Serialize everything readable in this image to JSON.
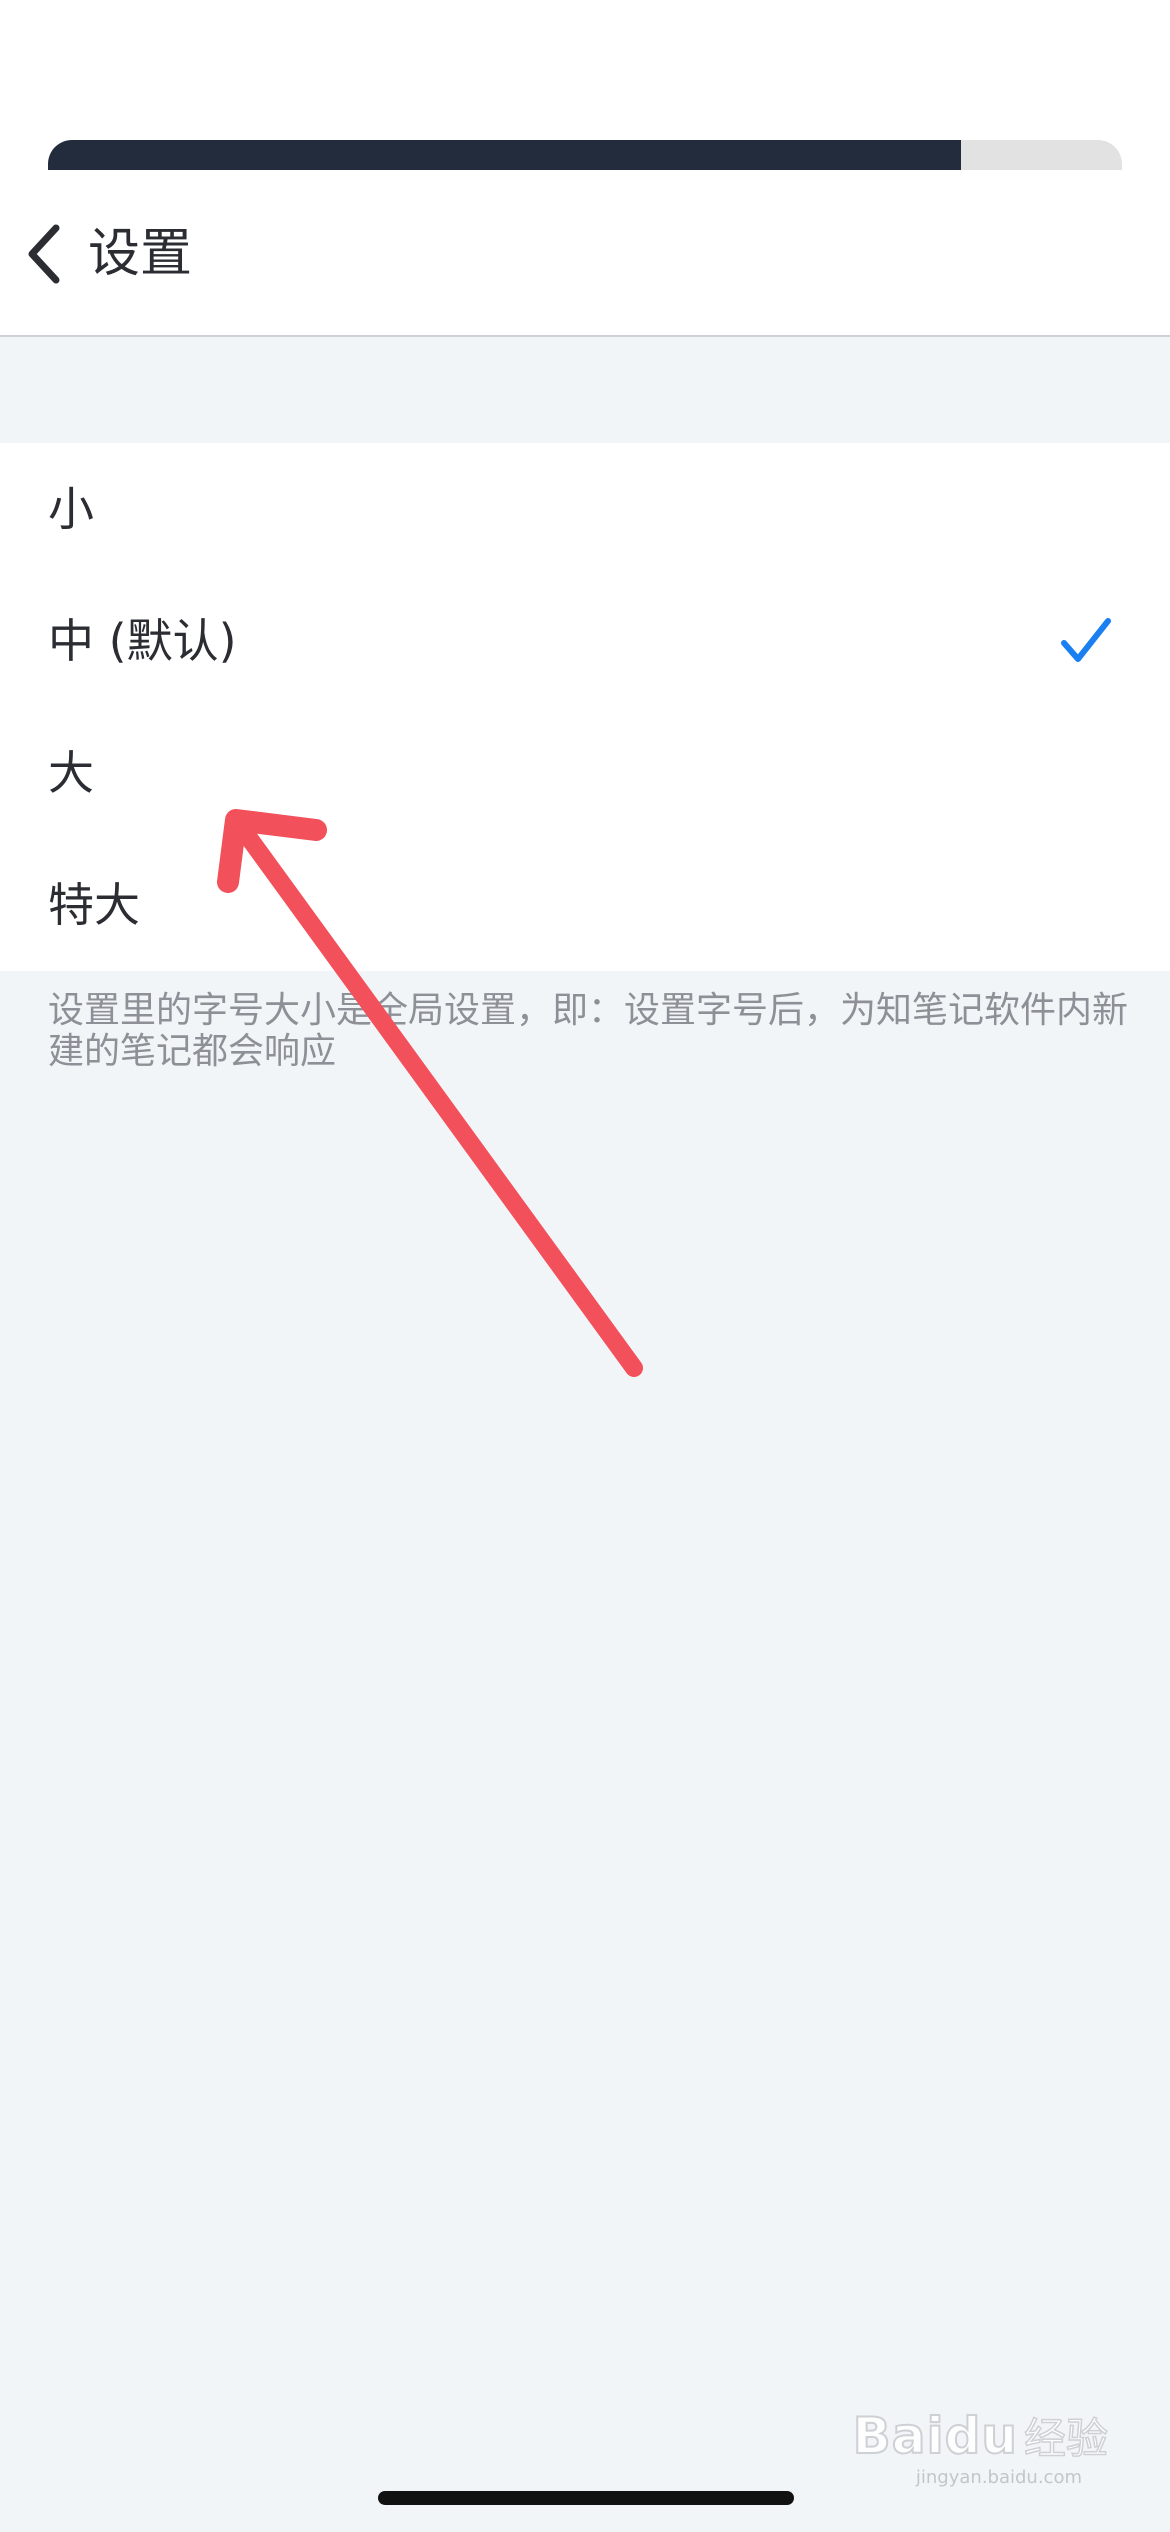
{
  "progress": {
    "value": 0.85
  },
  "nav": {
    "title": "设置",
    "back_icon": "chevron-left-icon"
  },
  "font_size_options": [
    {
      "label": "小",
      "selected": false
    },
    {
      "label": "中 (默认)",
      "selected": true
    },
    {
      "label": "大",
      "selected": false
    },
    {
      "label": "特大",
      "selected": false
    }
  ],
  "footnote": "设置里的字号大小是全局设置，即：设置字号后，为知笔记软件内新建的笔记都会响应",
  "colors": {
    "accent": "#1a7ff0",
    "annotation_arrow": "#f2505a",
    "background": "#f2f5f8",
    "progress_fill": "#222c3c"
  },
  "watermark": {
    "logo": "Baidu",
    "brand": "经验",
    "domain": "jingyan.baidu.com"
  }
}
